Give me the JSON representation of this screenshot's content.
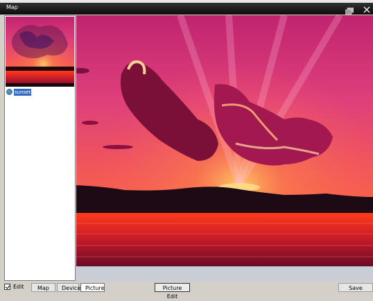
{
  "window": {
    "title": "Map"
  },
  "tree": {
    "items": [
      {
        "label": "sunset"
      }
    ]
  },
  "toolbar": {
    "edit_label": "Edit",
    "edit_checked": true,
    "tabs": [
      {
        "label": "Map"
      },
      {
        "label": "Device"
      },
      {
        "label": "Picture",
        "active": true
      }
    ],
    "picture_edit_label": "Picture Edit",
    "save_label": "Save"
  },
  "icons": [
    "restore-icon",
    "close-icon",
    "globe-icon"
  ]
}
